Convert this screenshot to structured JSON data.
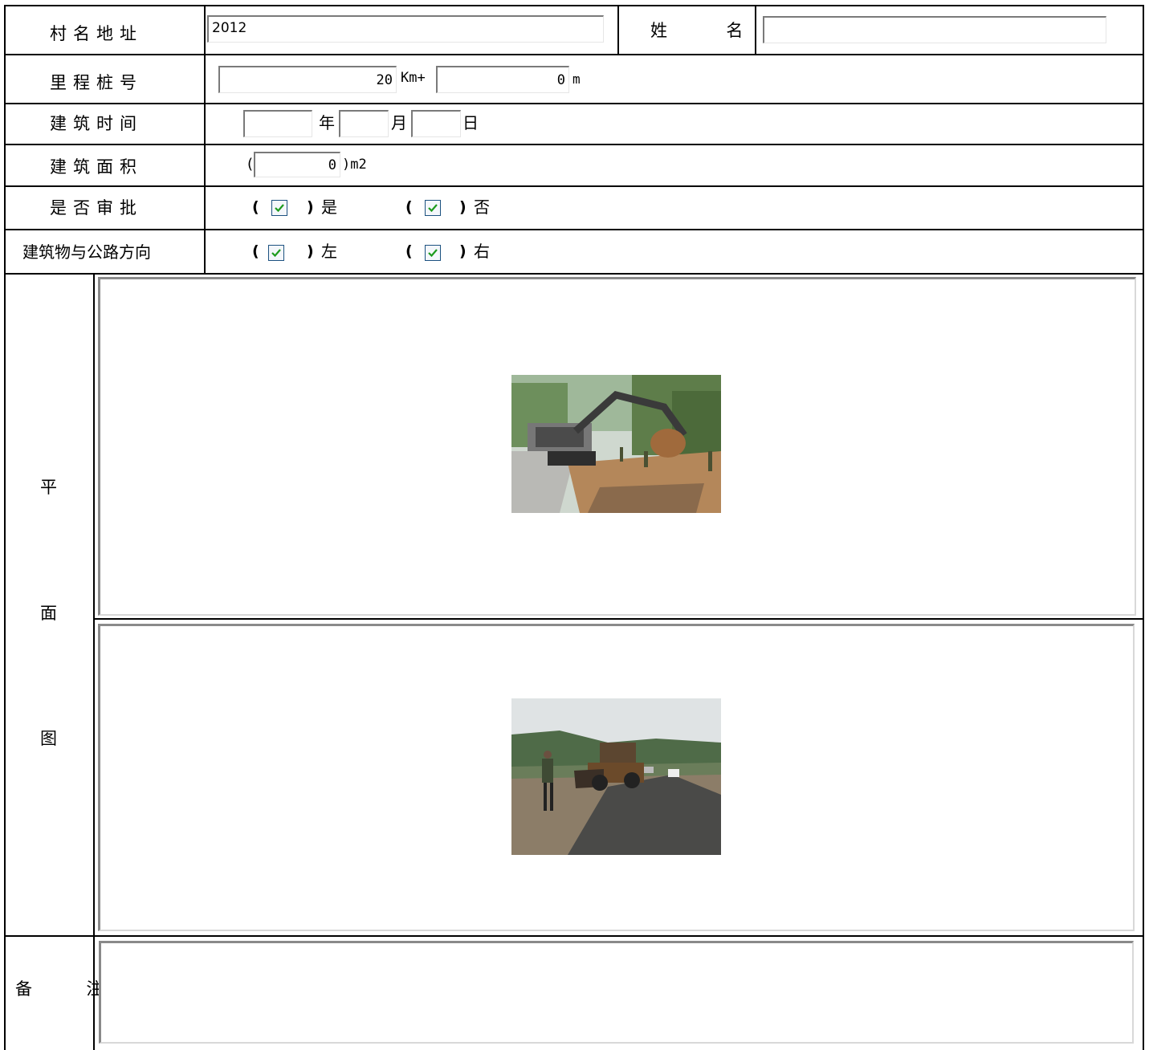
{
  "form": {
    "village_label": "村名地址",
    "village_value": "2012",
    "name_label": "姓  名",
    "name_value": "",
    "mileage_label": "里程桩号",
    "mileage_km_value": "20",
    "mileage_km_unit": "Km+",
    "mileage_m_value": "0",
    "mileage_m_unit": "m",
    "build_time_label": "建筑时间",
    "year_value": "",
    "year_unit": "年",
    "month_value": "",
    "month_unit": "月",
    "day_value": "",
    "day_unit": "日",
    "area_label": "建筑面积",
    "area_open": "(",
    "area_value": "0",
    "area_unit": ")m2",
    "approval_label": "是否审批",
    "approval_yes": "是",
    "approval_no": "否",
    "approval_yes_checked": true,
    "approval_no_checked": true,
    "direction_label": "建筑物与公路方向",
    "direction_left": "左",
    "direction_right": "右",
    "direction_left_checked": true,
    "direction_right_checked": true,
    "plan_label_1": "平",
    "plan_label_2": "面",
    "plan_label_3": "图",
    "remark_label": "备  注",
    "remark_value": "",
    "paren_open": "(",
    "paren_close": ")"
  },
  "colors": {
    "border": "#000000",
    "checkbox_border": "#1c5180",
    "check_mark": "#1d9b1d"
  }
}
